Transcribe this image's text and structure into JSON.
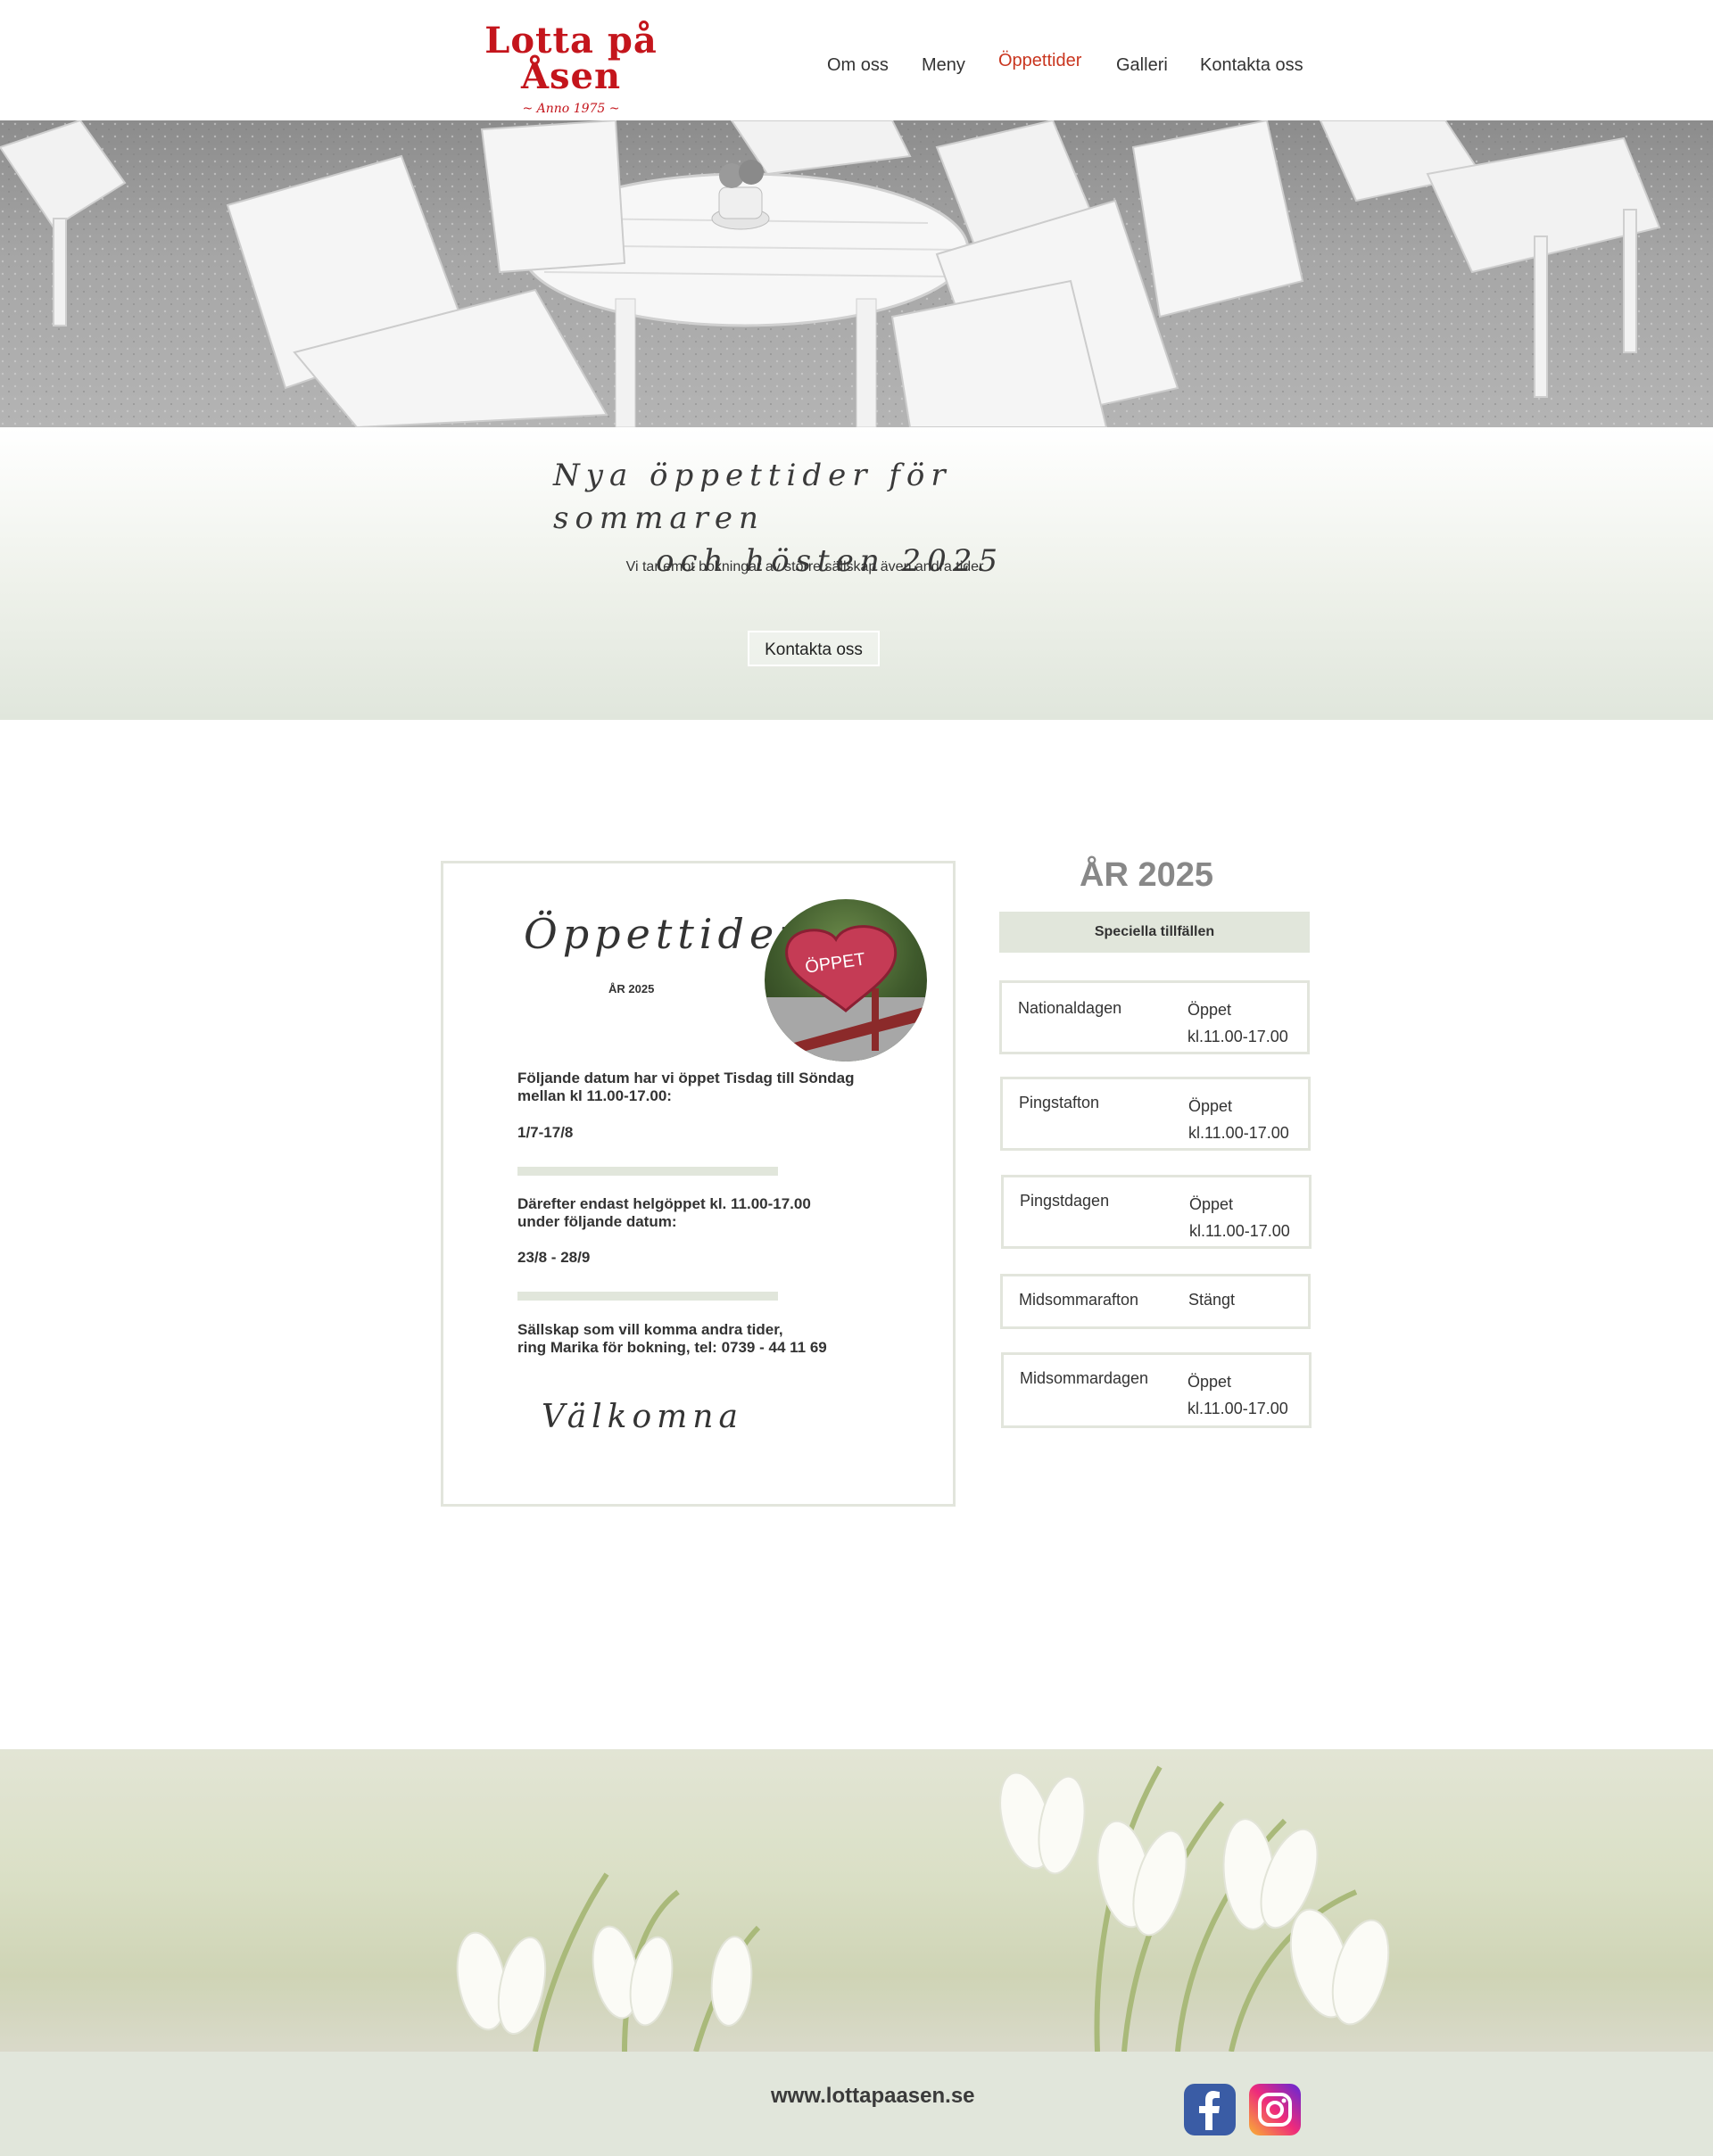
{
  "header": {
    "logo_title": "Lotta på Åsen",
    "logo_subtitle": "~ Anno 1975 ~",
    "nav": [
      {
        "label": "Om oss"
      },
      {
        "label": "Meny"
      },
      {
        "label": "Öppettider",
        "active": true
      },
      {
        "label": "Galleri"
      },
      {
        "label": "Kontakta oss"
      }
    ],
    "active_color": "#c9361f",
    "brand_color": "#c4151c"
  },
  "banner": {
    "title_line1": "Nya öppettider för sommaren",
    "title_line2": "och hösten 2025",
    "subtitle": "Vi tar emot bokningar av större sällskap även andra tider",
    "button_label": "Kontakta oss"
  },
  "card": {
    "title": "Öppettider",
    "year": "ÅR 2025",
    "badge_text": "ÖPPET",
    "paragraph1": "Följande datum har vi öppet Tisdag till Söndag mellan kl 11.00-17.00:",
    "dates1": "1/7-17/8",
    "paragraph2_line1": "Därefter endast helgöppet kl. 11.00-17.00",
    "paragraph2_line2": "under följande datum:",
    "dates2": "23/8 - 28/9",
    "paragraph3_line1": "Sällskap som vill komma andra tider,",
    "paragraph3_line2": "ring Marika för bokning, tel: 0739 - 44 11 69",
    "welcome": "Välkomna"
  },
  "special": {
    "year_heading": "ÅR 2025",
    "header": "Speciella tillfällen",
    "days": [
      {
        "name": "Nationaldagen",
        "status": "Öppet",
        "time": "kl.11.00-17.00"
      },
      {
        "name": "Pingstafton",
        "status": "Öppet",
        "time": "kl.11.00-17.00"
      },
      {
        "name": "Pingstdagen",
        "status": "Öppet",
        "time": "kl.11.00-17.00"
      },
      {
        "name": "Midsommarafton",
        "status": "Stängt",
        "time": ""
      },
      {
        "name": "Midsommardagen",
        "status": "Öppet",
        "time": "kl.11.00-17.00"
      }
    ]
  },
  "footer": {
    "url": "www.lottapaasen.se",
    "facebook_icon": "facebook-icon",
    "instagram_icon": "instagram-icon"
  }
}
